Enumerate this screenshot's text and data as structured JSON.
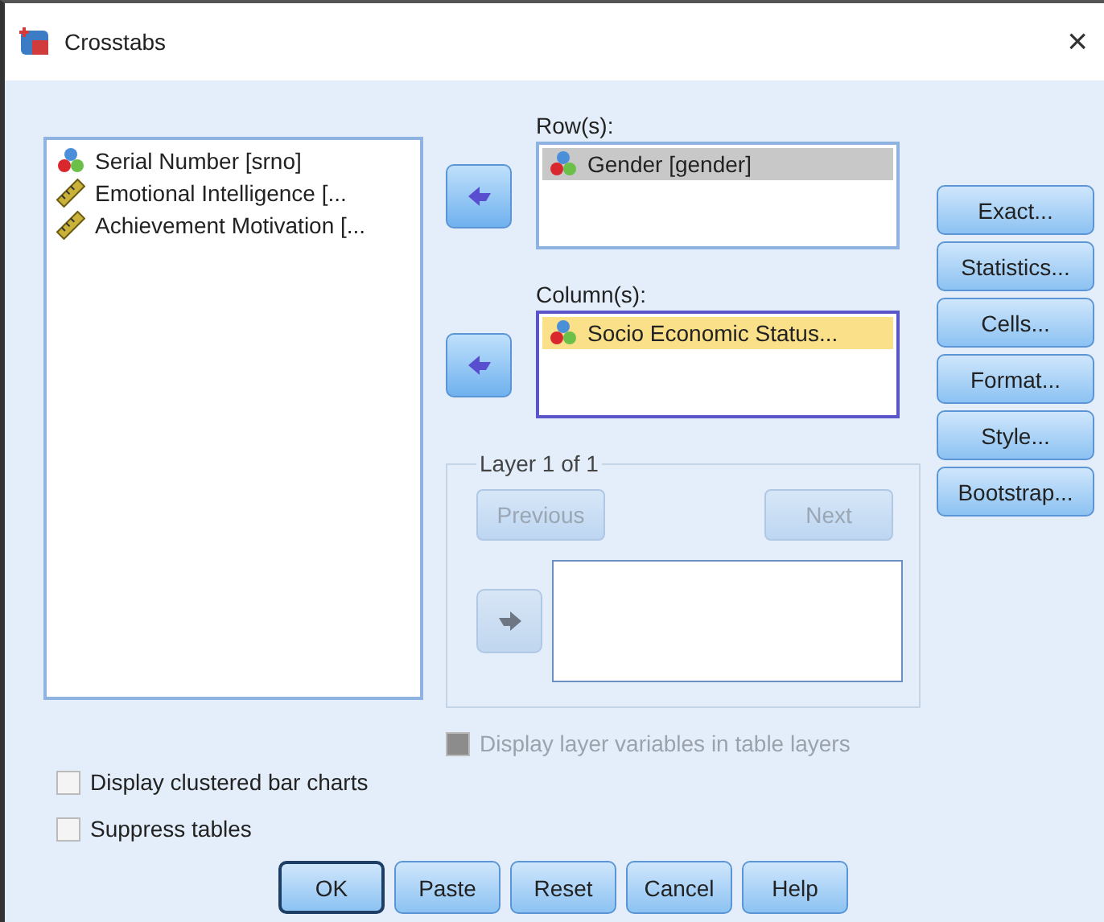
{
  "window": {
    "title": "Crosstabs",
    "close": "×"
  },
  "variables": [
    {
      "name": "Serial Number  [srno]",
      "kind": "nominal"
    },
    {
      "name": "Emotional Intelligence  [...",
      "kind": "scale"
    },
    {
      "name": "Achievement Motivation  [...",
      "kind": "scale"
    }
  ],
  "targets": [
    {
      "label": "Row(s):",
      "focused": false,
      "items": [
        {
          "name": "Gender  [gender]",
          "kind": "nominal",
          "selected": true
        }
      ]
    },
    {
      "label": "Column(s):",
      "focused": true,
      "items": [
        {
          "name": "Socio Economic Status...",
          "kind": "nominal",
          "selected": true
        }
      ]
    }
  ],
  "layer": {
    "title": "Layer 1 of 1",
    "previous": {
      "label": "Previous",
      "disabled": true
    },
    "next": {
      "label": "Next",
      "disabled": true
    },
    "arrow_disabled": true
  },
  "layer_option": {
    "label": "Display layer variables in table layers",
    "checked": false,
    "disabled": true
  },
  "side_buttons": [
    "Exact...",
    "Statistics...",
    "Cells...",
    "Format...",
    "Style...",
    "Bootstrap..."
  ],
  "options": [
    {
      "label": "Display clustered bar charts",
      "checked": false
    },
    {
      "label": "Suppress tables",
      "checked": false
    }
  ],
  "buttons": [
    {
      "label": "OK",
      "default": true
    },
    {
      "label": "Paste",
      "default": false
    },
    {
      "label": "Reset",
      "default": false
    },
    {
      "label": "Cancel",
      "default": false
    },
    {
      "label": "Help",
      "default": false
    }
  ]
}
